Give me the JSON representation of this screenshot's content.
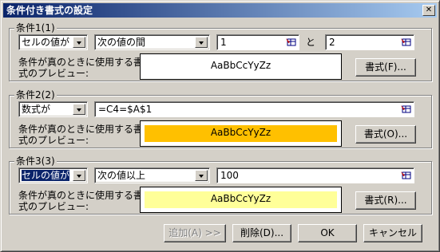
{
  "window": {
    "title": "条件付き書式の設定",
    "close_glyph": "✕"
  },
  "condition1": {
    "label": "条件1(1)",
    "type_value": "セルの値が",
    "operator_value": "次の値の間",
    "value1": "1",
    "and_label": "と",
    "value2": "2",
    "preview_label_line1": "条件が真のときに使用する書",
    "preview_label_line2": "式のプレビュー:",
    "preview_text": "AaBbCcYyZz",
    "preview_bg": "#ffffff",
    "format_button": "書式(F)..."
  },
  "condition2": {
    "label": "条件2(2)",
    "type_value": "数式が",
    "formula_value": "=C4=$A$1",
    "preview_label_line1": "条件が真のときに使用する書",
    "preview_label_line2": "式のプレビュー:",
    "preview_text": "AaBbCcYyZz",
    "preview_bg": "#ffc000",
    "format_button": "書式(O)..."
  },
  "condition3": {
    "label": "条件3(3)",
    "type_value": "セルの値が",
    "operator_value": "次の値以上",
    "value1": "100",
    "preview_label_line1": "条件が真のときに使用する書",
    "preview_label_line2": "式のプレビュー:",
    "preview_text": "AaBbCcYyZz",
    "preview_bg": "#ffff99",
    "format_button": "書式(R)..."
  },
  "footer": {
    "add_button": "追加(A) >>",
    "delete_button": "削除(D)...",
    "ok_button": "OK",
    "cancel_button": "キャンセル"
  },
  "colors": {
    "titlebar_start": "#0a246a",
    "titlebar_end": "#a6caf0",
    "dialog_bg": "#d4d0c8"
  }
}
